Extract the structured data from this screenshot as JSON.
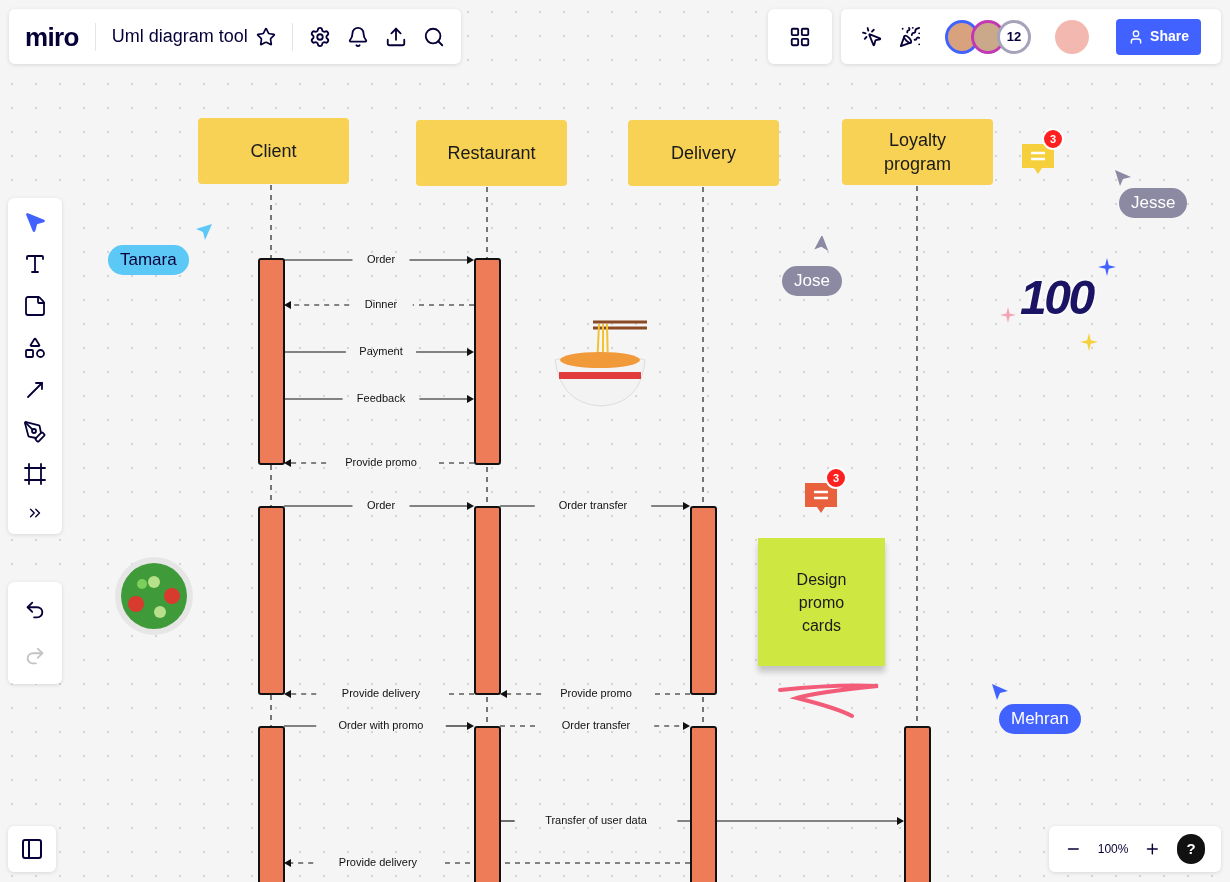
{
  "top_bar": {
    "logo": "miro",
    "board_title": "Uml diagram tool"
  },
  "share_button": {
    "label": "Share"
  },
  "collaborators": {
    "count": "12"
  },
  "lifelines": [
    {
      "name": "Client"
    },
    {
      "name": "Restaurant"
    },
    {
      "name": "Delivery"
    },
    {
      "name": "Loyalty program"
    }
  ],
  "messages": [
    {
      "label": "Order",
      "kind": "sync"
    },
    {
      "label": "Dinner",
      "kind": "async"
    },
    {
      "label": "Payment",
      "kind": "sync"
    },
    {
      "label": "Feedback",
      "kind": "sync"
    },
    {
      "label": "Provide promo",
      "kind": "async"
    },
    {
      "label": "Order",
      "kind": "sync"
    },
    {
      "label": "Order transfer",
      "kind": "sync"
    },
    {
      "label": "Provide delivery",
      "kind": "async"
    },
    {
      "label": "Provide promo",
      "kind": "async"
    },
    {
      "label": "Order with promo",
      "kind": "sync"
    },
    {
      "label": "Order transfer",
      "kind": "async"
    },
    {
      "label": "Transfer of user data",
      "kind": "sync"
    },
    {
      "label": "Provide delivery",
      "kind": "async"
    }
  ],
  "cursors": [
    {
      "name": "Tamara",
      "color": "#5bc8f5"
    },
    {
      "name": "Jose",
      "color": "#8c8aa3"
    },
    {
      "name": "Jesse",
      "color": "#8c8aa3"
    },
    {
      "name": "Mehran",
      "color": "#4262ff"
    }
  ],
  "comments": [
    {
      "count": "3",
      "color": "#f6cf3d"
    },
    {
      "count": "3",
      "color": "#e8603c"
    }
  ],
  "sticky_note": {
    "text": "Design promo cards"
  },
  "sticker": {
    "text": "100"
  },
  "tools": [
    {
      "kind": "select",
      "selected": true
    },
    {
      "kind": "text",
      "selected": false
    },
    {
      "kind": "sticky",
      "selected": false
    },
    {
      "kind": "shapes",
      "selected": false
    },
    {
      "kind": "arrow",
      "selected": false
    },
    {
      "kind": "pen",
      "selected": false
    },
    {
      "kind": "frame",
      "selected": false
    },
    {
      "kind": "more",
      "selected": false
    }
  ],
  "undo": {
    "disabled": false
  },
  "redo": {
    "disabled": true
  },
  "zoom_level": "100%",
  "help": "?"
}
